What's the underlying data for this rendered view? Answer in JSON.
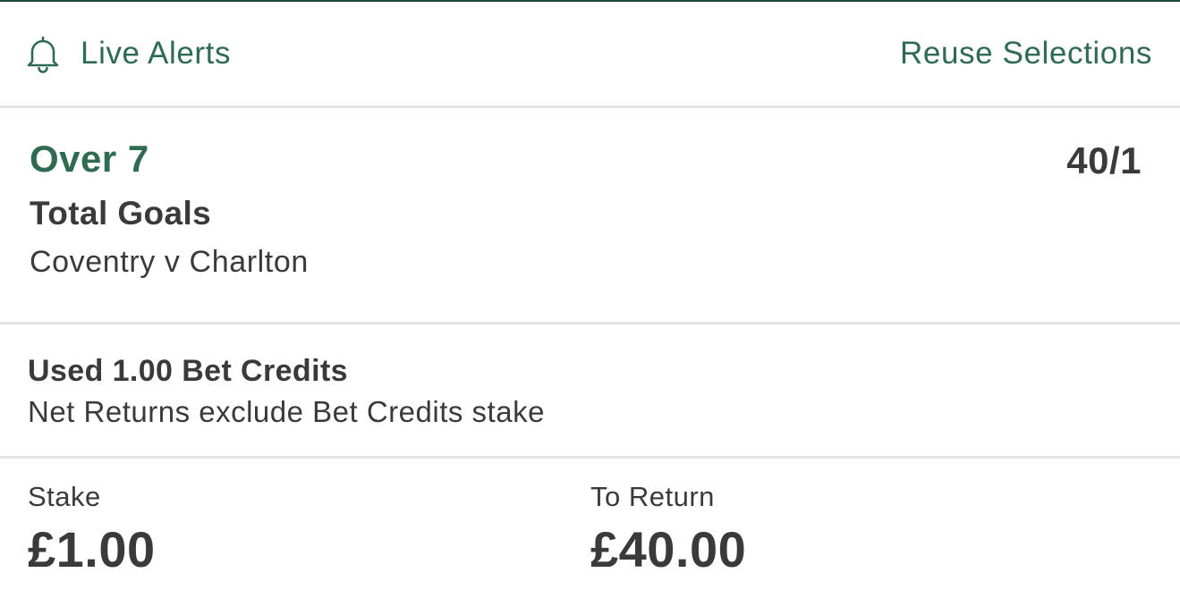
{
  "header": {
    "live_alerts_label": "Live Alerts",
    "bell_icon": "bell-icon",
    "reuse_label": "Reuse Selections"
  },
  "selection": {
    "name": "Over 7",
    "odds": "40/1",
    "market": "Total Goals",
    "event": "Coventry v Charlton"
  },
  "bet_credits": {
    "title": "Used 1.00 Bet Credits",
    "note": "Net Returns exclude Bet Credits stake"
  },
  "totals": {
    "stake_label": "Stake",
    "stake_value": "£1.00",
    "return_label": "To Return",
    "return_value": "£40.00"
  },
  "colors": {
    "accent": "#2f6b51",
    "text": "#3a3a3a",
    "divider": "#e3e3e3",
    "top_border": "#1f4a3a"
  }
}
